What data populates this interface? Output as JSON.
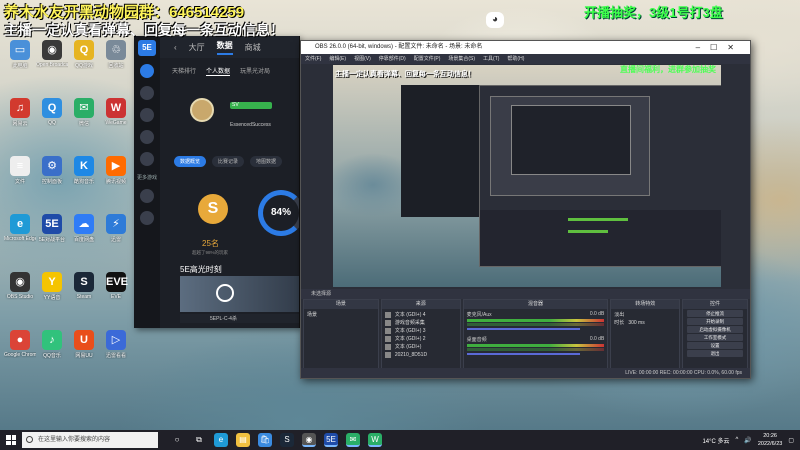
{
  "overlay": {
    "top_line": "养木水友开黑动物园群：646514259",
    "second_line": "主播一定认真看弹幕、回复每一条互动信息！",
    "right_banner": "开播抽奖，3级1号打3盘",
    "right_small": "直播间福利，进群参加抽奖"
  },
  "desktop_icons": [
    {
      "label": "此电脑",
      "color": "#4a90d9",
      "glyph": "▭"
    },
    {
      "label": "Open Broadcaster",
      "color": "#3a3a3a",
      "glyph": "◉"
    },
    {
      "label": "QQ游戏",
      "color": "#e6b422",
      "glyph": "Q"
    },
    {
      "label": "回收站",
      "color": "#7a8a99",
      "glyph": "♲"
    },
    {
      "label": "网易云",
      "color": "#d23a2e",
      "glyph": "♫"
    },
    {
      "label": "QQ",
      "color": "#2f8fe0",
      "glyph": "Q"
    },
    {
      "label": "微信",
      "color": "#2aae67",
      "glyph": "✉"
    },
    {
      "label": "WeGame",
      "color": "#c33",
      "glyph": "W"
    },
    {
      "label": "文件",
      "color": "#eee",
      "glyph": "≡"
    },
    {
      "label": "控制面板",
      "color": "#3a6fc9",
      "glyph": "⚙"
    },
    {
      "label": "酷狗音乐",
      "color": "#1e88e5",
      "glyph": "K"
    },
    {
      "label": "腾讯视频",
      "color": "#ff6b00",
      "glyph": "▶"
    },
    {
      "label": "Microsoft Edge",
      "color": "#1f9ad6",
      "glyph": "e"
    },
    {
      "label": "5E对战平台",
      "color": "#1f4ba8",
      "glyph": "5E"
    },
    {
      "label": "百度网盘",
      "color": "#2f7cf6",
      "glyph": "☁"
    },
    {
      "label": "迅雷",
      "color": "#2e7bd8",
      "glyph": "⚡"
    },
    {
      "label": "OBS Studio",
      "color": "#333",
      "glyph": "◉"
    },
    {
      "label": "YY语音",
      "color": "#f5c400",
      "glyph": "Y"
    },
    {
      "label": "Steam",
      "color": "#1b2838",
      "glyph": "S"
    },
    {
      "label": "EVE",
      "color": "#111",
      "glyph": "EVE"
    },
    {
      "label": "Google Chrome",
      "color": "#db4437",
      "glyph": "●"
    },
    {
      "label": "QQ音乐",
      "color": "#31c27c",
      "glyph": "♪"
    },
    {
      "label": "网易UU",
      "color": "#e94e1b",
      "glyph": "U"
    },
    {
      "label": "迅雷看看",
      "color": "#3b6ad8",
      "glyph": "▷"
    }
  ],
  "game": {
    "rail_logo": "5E",
    "rail_label": "更多游戏",
    "tabs": [
      "大厅",
      "数据",
      "商城"
    ],
    "active_tab": "数据",
    "sub_tabs": [
      "天梯排行",
      "个人数据",
      "玩黑光对局"
    ],
    "badge": "SV",
    "player_name": "EssencedSuccess",
    "buttons": [
      "数据概览",
      "比赛记录",
      "地图数据"
    ],
    "rank_letter": "S",
    "rank_count": "25名",
    "rank_note": "超越了98%的玩家",
    "win_rate": "84%",
    "highlight_title": "5E高光时刻",
    "video_caption": "5EPL-C-4杀"
  },
  "obs": {
    "title": "OBS 26.0.0 (64-bit, windows) - 配置文件: 未命名 - 场景: 未命名",
    "menu": [
      "文件(F)",
      "编辑(E)",
      "视图(V)",
      "停靠部件(D)",
      "配置文件(P)",
      "场景集合(S)",
      "工具(T)",
      "帮助(H)"
    ],
    "dock_bar": "未选择源",
    "docks": {
      "scenes": {
        "title": "场景",
        "items": [
          "场景"
        ]
      },
      "sources": {
        "title": "来源",
        "items": [
          "文本 (GDI+) 4",
          "游戏音频采集",
          "文本 (GDI+) 3",
          "文本 (GDI+) 2",
          "文本 (GDI+)",
          "20210_8D51D"
        ]
      },
      "mixer": {
        "title": "混音器",
        "channels": [
          {
            "name": "麦克风/Aux",
            "db": "0.0 dB"
          },
          {
            "name": "桌面音频",
            "db": "0.0 dB"
          }
        ]
      },
      "transitions": {
        "title": "转场特效",
        "effect": "淡出",
        "duration_label": "时长",
        "duration": "300 ms"
      },
      "controls": {
        "title": "控件",
        "buttons": [
          "停止推流",
          "开始录制",
          "启动虚拟摄像机",
          "工作室模式",
          "设置",
          "退出"
        ]
      }
    },
    "status": "LIVE: 00:00:00    REC: 00:00:00    CPU: 0.0%, 60.00 fps"
  },
  "taskbar": {
    "search_placeholder": "在这里输入你要搜索的内容",
    "apps": [
      {
        "glyph": "○",
        "color": "#ffffff"
      },
      {
        "glyph": "⧉",
        "color": "#ffffff"
      },
      {
        "glyph": "e",
        "color": "#1f9ad6"
      },
      {
        "glyph": "▤",
        "color": "#f0c040"
      },
      {
        "glyph": "🛍",
        "color": "#3a8be0"
      },
      {
        "glyph": "S",
        "color": "#1b2838"
      },
      {
        "glyph": "◉",
        "color": "#555555"
      },
      {
        "glyph": "5E",
        "color": "#1f4ba8"
      },
      {
        "glyph": "✉",
        "color": "#2aae67"
      },
      {
        "glyph": "W",
        "color": "#2aae67"
      }
    ],
    "weather": "14°C 多云",
    "time": "20:26",
    "date": "2022/6/23"
  }
}
